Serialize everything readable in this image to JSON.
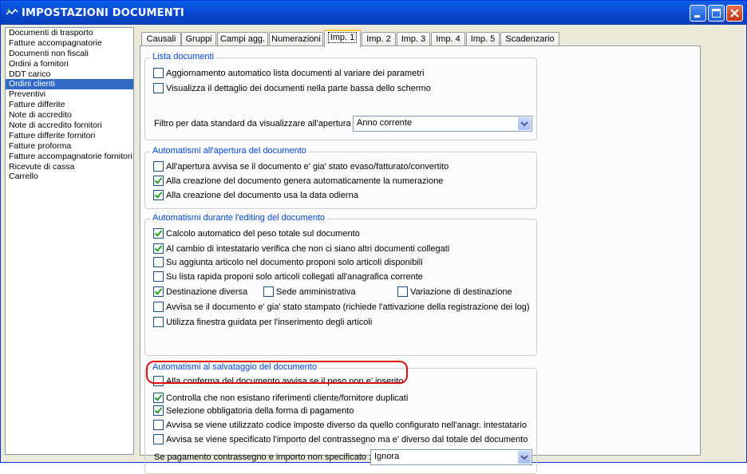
{
  "window": {
    "title": "IMPOSTAZIONI DOCUMENTI",
    "controls": [
      "minimize-icon",
      "maximize-icon",
      "close-icon"
    ]
  },
  "sidebar": {
    "items": [
      {
        "label": "Documenti di trasporto",
        "selected": false
      },
      {
        "label": "Fatture accompagnatorie",
        "selected": false
      },
      {
        "label": "Documenti non fiscali",
        "selected": false
      },
      {
        "label": "Ordini a fornitori",
        "selected": false
      },
      {
        "label": "DDT carico",
        "selected": false
      },
      {
        "label": "Ordini clienti",
        "selected": true
      },
      {
        "label": "Preventivi",
        "selected": false
      },
      {
        "label": "Fatture differite",
        "selected": false
      },
      {
        "label": "Note di accredito",
        "selected": false
      },
      {
        "label": "Note di accredito fornitori",
        "selected": false
      },
      {
        "label": "Fatture differite fornitori",
        "selected": false
      },
      {
        "label": "Fatture proforma",
        "selected": false
      },
      {
        "label": "Fatture accompagnatorie fornitori",
        "selected": false
      },
      {
        "label": "Ricevute di cassa",
        "selected": false
      },
      {
        "label": "Carrello",
        "selected": false
      }
    ]
  },
  "tabs": [
    {
      "label": "Causali",
      "active": false
    },
    {
      "label": "Gruppi",
      "active": false
    },
    {
      "label": "Campi agg.",
      "active": false
    },
    {
      "label": "Numerazioni",
      "active": false
    },
    {
      "label": "Imp. 1",
      "active": true
    },
    {
      "label": "Imp. 2",
      "active": false
    },
    {
      "label": "Imp. 3",
      "active": false
    },
    {
      "label": "Imp. 4",
      "active": false
    },
    {
      "label": "Imp. 5",
      "active": false
    },
    {
      "label": "Scadenzario",
      "active": false
    }
  ],
  "groups": {
    "lista": {
      "title": "Lista documenti",
      "options": [
        {
          "label": "Aggiornamento automatico lista documenti al variare dei parametri",
          "checked": false
        },
        {
          "label": "Visualizza il dettaglio dei documenti nella parte bassa dello schermo",
          "checked": false
        }
      ],
      "filter_label": "Filtro per data standard da visualizzare all'apertura :",
      "filter_value": "Anno corrente"
    },
    "apertura": {
      "title": "Automatismi all'apertura del documento",
      "options": [
        {
          "label": "All'apertura avvisa se il documento e' gia' stato evaso/fatturato/convertito",
          "checked": false
        },
        {
          "label": "Alla creazione del documento genera automaticamente la numerazione",
          "checked": true
        },
        {
          "label": "Alla creazione del documento usa la data odierna",
          "checked": true
        }
      ]
    },
    "editing": {
      "title": "Automatismi durante l'editing del documento",
      "options": [
        {
          "label": "Calcolo automatico del peso totale sul documento",
          "checked": true
        },
        {
          "label": "Al cambio di intestatario verifica che non ci siano altri documenti collegati",
          "checked": true
        },
        {
          "label": "Su aggiunta articolo nel documento proponi solo articoli disponibili",
          "checked": false
        },
        {
          "label": "Su lista rapida proponi solo articoli collegati all'anagrafica corrente",
          "checked": false
        },
        {
          "label": "Destinazione diversa",
          "checked": true
        },
        {
          "label": "Sede amministrativa",
          "checked": false
        },
        {
          "label": "Variazione di destinazione",
          "checked": false
        },
        {
          "label": "Avvisa se il documento e' gia' stato stampato (richiede l'attivazione della registrazione dei log)",
          "checked": false
        },
        {
          "label": "Utilizza finestra guidata per l'inserimento degli articoli",
          "checked": false
        }
      ]
    },
    "salvataggio": {
      "title": "Automatismi al salvataggio del documento",
      "options": [
        {
          "label": "Alla conferma del documento avvisa se il peso non e' inserito",
          "checked": false
        },
        {
          "label": "Controlla che non esistano riferimenti cliente/fornitore duplicati",
          "checked": true
        },
        {
          "label": "Selezione obbligatoria della forma di pagamento",
          "checked": true
        },
        {
          "label": "Avvisa se viene utilizzato codice imposte diverso da quello configurato nell'anagr. intestatario",
          "checked": false
        },
        {
          "label": "Avvisa se viene specificato l'importo del contrassegno ma e' diverso dal totale del documento",
          "checked": false
        }
      ],
      "pagamento_label": "Se pagamento contrassegno e importo non specificato :",
      "pagamento_value": "Ignora"
    }
  },
  "colors": {
    "titlebar": "#0a4ad4",
    "selection": "#316ac5",
    "group_title": "#0046d5",
    "check": "#21a121",
    "highlight": "#e01010"
  }
}
